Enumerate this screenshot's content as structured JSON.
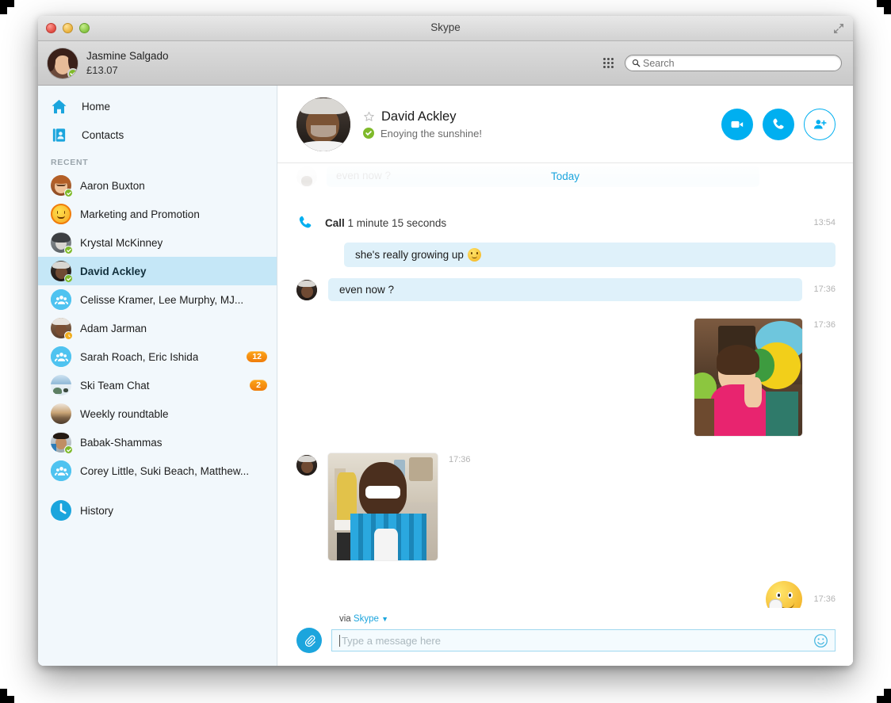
{
  "window": {
    "title": "Skype",
    "controls": {
      "close": "close",
      "minimize": "minimize",
      "zoom": "zoom"
    },
    "fullscreen_label": "Enter Full Screen"
  },
  "account": {
    "name": "Jasmine Salgado",
    "balance": "£13.07",
    "presence": "online",
    "dialpad_label": "Dial pad"
  },
  "search": {
    "placeholder": "Search",
    "value": ""
  },
  "sidebar": {
    "nav": [
      {
        "label": "Home",
        "icon": "home-icon"
      },
      {
        "label": "Contacts",
        "icon": "contacts-icon"
      }
    ],
    "section_label": "RECENT",
    "contacts": [
      {
        "name": "Aaron Buxton",
        "presence": "online",
        "badge": "",
        "type": "person",
        "active": false
      },
      {
        "name": "Marketing and Promotion",
        "presence": "",
        "badge": "",
        "type": "emoji",
        "active": false
      },
      {
        "name": "Krystal McKinney",
        "presence": "online",
        "badge": "",
        "type": "person",
        "active": false
      },
      {
        "name": "David Ackley",
        "presence": "online",
        "badge": "",
        "type": "person",
        "active": true
      },
      {
        "name": "Celisse Kramer, Lee Murphy, MJ...",
        "presence": "",
        "badge": "",
        "type": "group",
        "active": false
      },
      {
        "name": "Adam Jarman",
        "presence": "away",
        "badge": "",
        "type": "person",
        "active": false
      },
      {
        "name": "Sarah Roach, Eric Ishida",
        "presence": "",
        "badge": "12",
        "type": "group",
        "active": false
      },
      {
        "name": "Ski Team Chat",
        "presence": "",
        "badge": "2",
        "type": "photo",
        "active": false
      },
      {
        "name": "Weekly roundtable",
        "presence": "",
        "badge": "",
        "type": "photo",
        "active": false
      },
      {
        "name": "Babak-Shammas",
        "presence": "online",
        "badge": "",
        "type": "person",
        "active": false
      },
      {
        "name": "Corey Little, Suki Beach, Matthew...",
        "presence": "",
        "badge": "",
        "type": "group",
        "active": false
      }
    ],
    "history": {
      "label": "History",
      "icon": "clock-icon"
    }
  },
  "conversation": {
    "contact_name": "David Ackley",
    "mood_message": "Enoying the sunshine!",
    "presence": "online",
    "favorite_label": "Add to favorites",
    "actions": [
      {
        "name": "video-call",
        "label": "Video call"
      },
      {
        "name": "voice-call",
        "label": "Call"
      },
      {
        "name": "add-people",
        "label": "Add people"
      }
    ],
    "day_divider": "Today",
    "faded_message": "even now ?",
    "messages": [
      {
        "kind": "call",
        "label": "Call",
        "detail": "1 minute 15 seconds",
        "time": "13:54"
      },
      {
        "kind": "text-out",
        "text": "she's really growing up",
        "emoji": "smiley",
        "time": ""
      },
      {
        "kind": "text-in",
        "text": "even now ?",
        "time": "17:36"
      },
      {
        "kind": "image-out",
        "alt": "Girl holding colorful balloons at a party",
        "time": "17:36"
      },
      {
        "kind": "image-in",
        "alt": "Smiling boy in blue plaid shirt with a trophy",
        "time": "17:36"
      },
      {
        "kind": "emoticon-out",
        "alt": "giggling emoticon",
        "time": "17:36"
      }
    ]
  },
  "composer": {
    "via_prefix": "via",
    "via_service": "Skype",
    "placeholder": "Type a message here",
    "value": "",
    "attach_label": "Send file",
    "emoticon_label": "Emoticons"
  },
  "colors": {
    "accent": "#00aff0",
    "bubble": "#dff1fa",
    "selection": "#c5e7f7",
    "badge": "#f07c0a",
    "presence_online": "#7fba2a",
    "presence_away": "#f0ad1e"
  }
}
